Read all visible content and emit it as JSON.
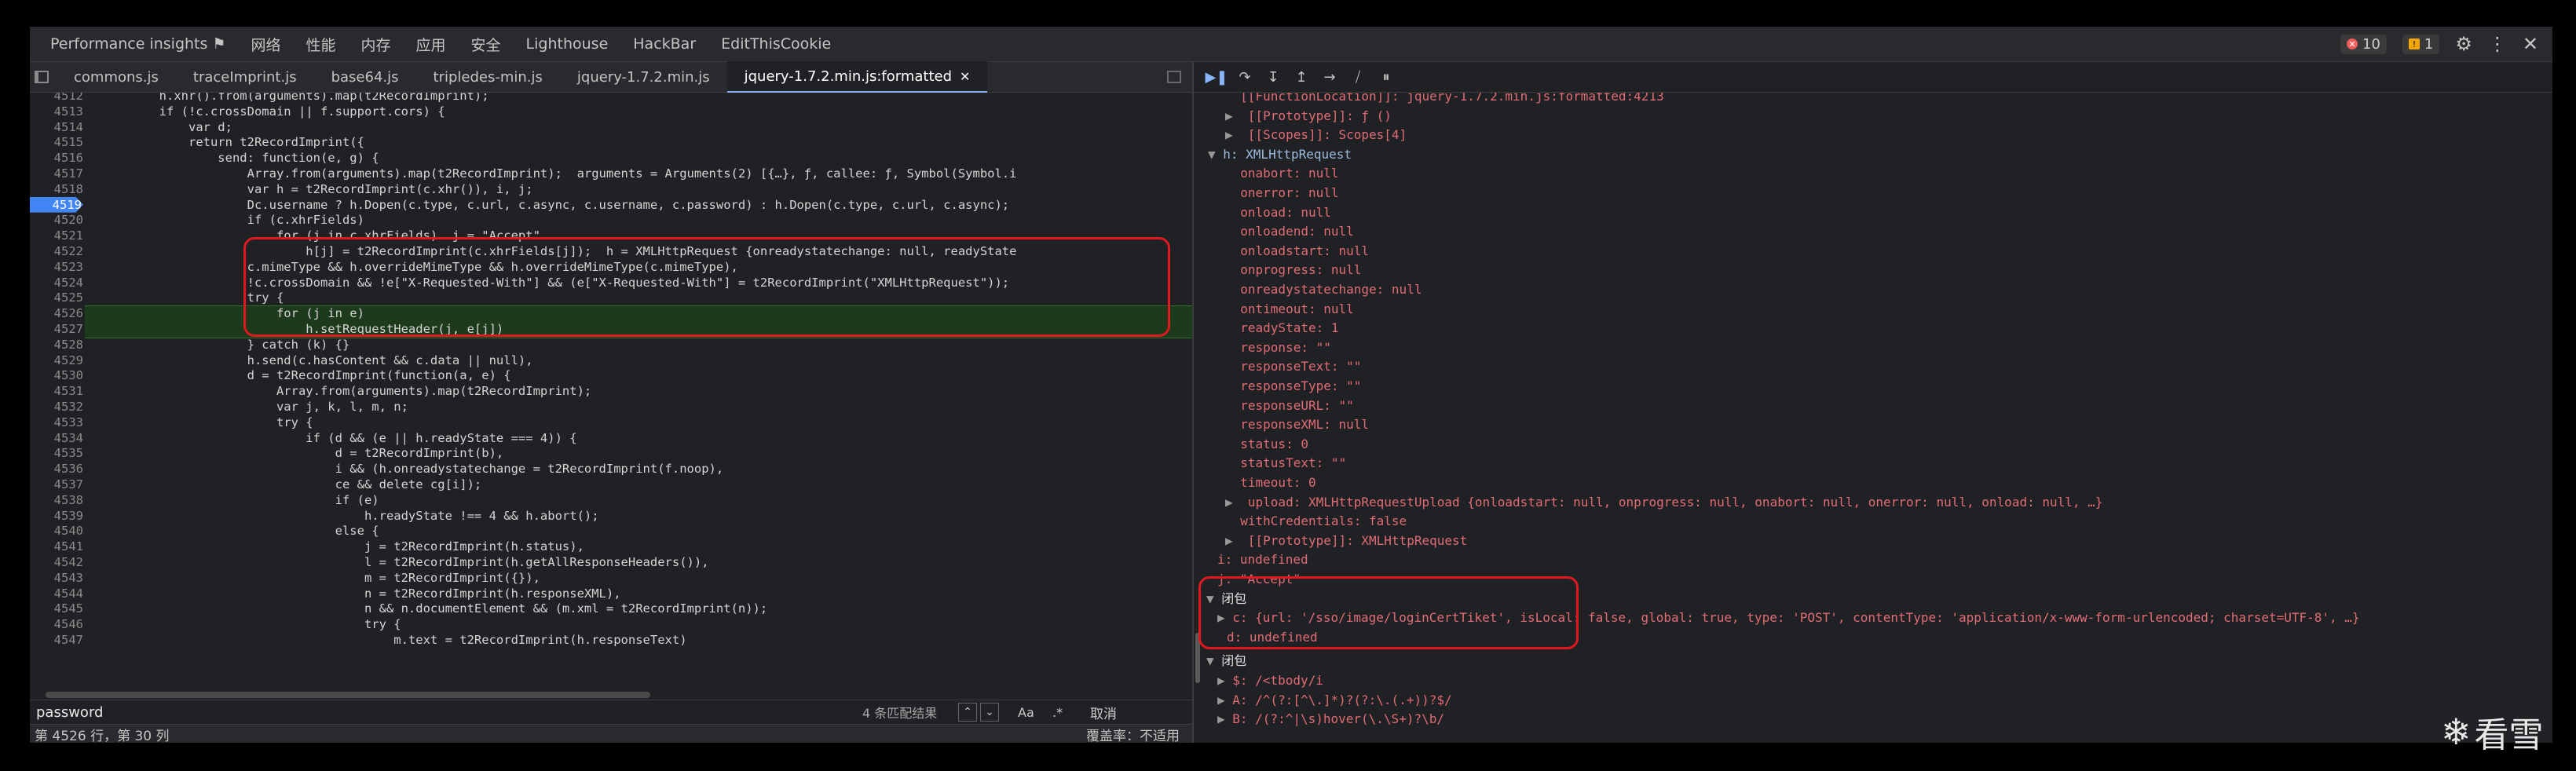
{
  "top_tabs": [
    "Performance insights ⚑",
    "网络",
    "性能",
    "内存",
    "应用",
    "安全",
    "Lighthouse",
    "HackBar",
    "EditThisCookie"
  ],
  "errors_count": "10",
  "warnings_count": "1",
  "file_tabs": [
    "commons.js",
    "traceImprint.js",
    "base64.js",
    "tripledes-min.js",
    "jquery-1.7.2.min.js",
    "jquery-1.7.2.min.js:formatted"
  ],
  "active_file_tab": 5,
  "code_lines": [
    {
      "no": "4512",
      "text": "        h.xhr().from(arguments).map(t2RecordImprint);"
    },
    {
      "no": "4513",
      "text": "        if (!c.crossDomain || f.support.cors) {"
    },
    {
      "no": "4514",
      "text": "            var d;"
    },
    {
      "no": "4515",
      "text": "            return t2RecordImprint({"
    },
    {
      "no": "4516",
      "text": "                send: function(e, g) {"
    },
    {
      "no": "4517",
      "text": "                    Array.from(arguments).map(t2RecordImprint);  arguments = Arguments(2) [{…}, ƒ, callee: ƒ, Symbol(Symbol.i"
    },
    {
      "no": "4518",
      "text": "                    var h = t2RecordImprint(c.xhr()), i, j;"
    },
    {
      "no": "4519",
      "text": "                    Dc.username ? h.Dopen(c.type, c.url, c.async, c.username, c.password) : h.Dopen(c.type, c.url, c.async);"
    },
    {
      "no": "4520",
      "text": "                    if (c.xhrFields)"
    },
    {
      "no": "4521",
      "text": "                        for (j in c.xhrFields)  j = \"Accept\""
    },
    {
      "no": "4522",
      "text": "                            h[j] = t2RecordImprint(c.xhrFields[j]);  h = XMLHttpRequest {onreadystatechange: null, readyState"
    },
    {
      "no": "4523",
      "text": "                    c.mimeType && h.overrideMimeType && h.overrideMimeType(c.mimeType),"
    },
    {
      "no": "4524",
      "text": "                    !c.crossDomain && !e[\"X-Requested-With\"] && (e[\"X-Requested-With\"] = t2RecordImprint(\"XMLHttpRequest\"));"
    },
    {
      "no": "4525",
      "text": "                    try {"
    },
    {
      "no": "4526",
      "text": "                        for (j in e)"
    },
    {
      "no": "4527",
      "text": "                            h.setRequestHeader(j, e[j])"
    },
    {
      "no": "4528",
      "text": "                    } catch (k) {}"
    },
    {
      "no": "4529",
      "text": "                    h.send(c.hasContent && c.data || null),"
    },
    {
      "no": "4530",
      "text": "                    d = t2RecordImprint(function(a, e) {"
    },
    {
      "no": "4531",
      "text": "                        Array.from(arguments).map(t2RecordImprint);"
    },
    {
      "no": "4532",
      "text": "                        var j, k, l, m, n;"
    },
    {
      "no": "4533",
      "text": "                        try {"
    },
    {
      "no": "4534",
      "text": "                            if (d && (e || h.readyState === 4)) {"
    },
    {
      "no": "4535",
      "text": "                                d = t2RecordImprint(b),"
    },
    {
      "no": "4536",
      "text": "                                i && (h.onreadystatechange = t2RecordImprint(f.noop),"
    },
    {
      "no": "4537",
      "text": "                                ce && delete cg[i]);"
    },
    {
      "no": "4538",
      "text": "                                if (e)"
    },
    {
      "no": "4539",
      "text": "                                    h.readyState !== 4 && h.abort();"
    },
    {
      "no": "4540",
      "text": "                                else {"
    },
    {
      "no": "4541",
      "text": "                                    j = t2RecordImprint(h.status),"
    },
    {
      "no": "4542",
      "text": "                                    l = t2RecordImprint(h.getAllResponseHeaders()),"
    },
    {
      "no": "4543",
      "text": "                                    m = t2RecordImprint({}),"
    },
    {
      "no": "4544",
      "text": "                                    n = t2RecordImprint(h.responseXML),"
    },
    {
      "no": "4545",
      "text": "                                    n && n.documentElement && (m.xml = t2RecordImprint(n));"
    },
    {
      "no": "4546",
      "text": "                                    try {"
    },
    {
      "no": "4547",
      "text": "                                        m.text = t2RecordImprint(h.responseText)"
    }
  ],
  "breakpoint_line": "4519",
  "search": {
    "value": "password",
    "results": "4 条匹配结果",
    "match_case": "Aa",
    "regex": ".*",
    "cancel": "取消"
  },
  "status": {
    "position": "第 4526 行，第 30 列",
    "coverage": "覆盖率：不适用"
  },
  "scope_lines": [
    {
      "tri": "",
      "text": "  [[FunctionLocation]]: jquery-1.7.2.min.js:formatted:4213"
    },
    {
      "tri": "▶",
      "text": " [[Prototype]]: ƒ ()"
    },
    {
      "tri": "▶",
      "text": " [[Scopes]]: Scopes[4]"
    },
    {
      "tri": "▼",
      "text": "h: XMLHttpRequest"
    },
    {
      "tri": "",
      "text": "  onabort: null"
    },
    {
      "tri": "",
      "text": "  onerror: null"
    },
    {
      "tri": "",
      "text": "  onload: null"
    },
    {
      "tri": "",
      "text": "  onloadend: null"
    },
    {
      "tri": "",
      "text": "  onloadstart: null"
    },
    {
      "tri": "",
      "text": "  onprogress: null"
    },
    {
      "tri": "",
      "text": "  onreadystatechange: null"
    },
    {
      "tri": "",
      "text": "  ontimeout: null"
    },
    {
      "tri": "",
      "text": "  readyState: 1"
    },
    {
      "tri": "",
      "text": "  response: \"\""
    },
    {
      "tri": "",
      "text": "  responseText: \"\""
    },
    {
      "tri": "",
      "text": "  responseType: \"\""
    },
    {
      "tri": "",
      "text": "  responseURL: \"\""
    },
    {
      "tri": "",
      "text": "  responseXML: null"
    },
    {
      "tri": "",
      "text": "  status: 0"
    },
    {
      "tri": "",
      "text": "  statusText: \"\""
    },
    {
      "tri": "",
      "text": "  timeout: 0"
    },
    {
      "tri": "▶",
      "text": " upload: XMLHttpRequestUpload {onloadstart: null, onprogress: null, onabort: null, onerror: null, onload: null, …}"
    },
    {
      "tri": "",
      "text": "  withCredentials: false"
    },
    {
      "tri": "▶",
      "text": " [[Prototype]]: XMLHttpRequest"
    },
    {
      "tri": "",
      "text": "i: undefined"
    },
    {
      "tri": "",
      "text": "j: \"Accept\""
    }
  ],
  "closure1": {
    "header": "闭包",
    "c_line": "c: {url: '/sso/image/loginCertTiket', isLocal: false, global: true, type: 'POST', contentType: 'application/x-www-form-urlencoded; charset=UTF-8', …}",
    "d_line": "d: undefined"
  },
  "closure2": {
    "header": "闭包",
    "lines": [
      "$: /<tbody/i",
      "A: /^(?:[^\\.]*)?(?:\\.(.+))?$/",
      "B: /(?:^|\\s)hover(\\.\\S+)?\\b/"
    ]
  },
  "watermark": "看雪"
}
